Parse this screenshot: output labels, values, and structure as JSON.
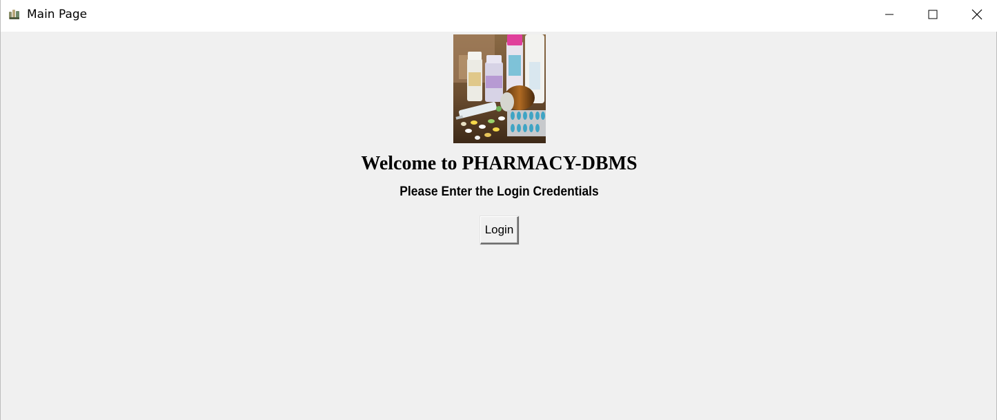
{
  "window": {
    "title": "Main Page",
    "app_icon": "pills-app-icon",
    "controls": [
      "minimize-icon",
      "maximize-icon",
      "close-icon"
    ]
  },
  "main": {
    "image": "medicine-bottles-and-pills-photo",
    "welcome_text": "Welcome to PHARMACY-DBMS",
    "subtitle": "Please Enter the Login Credentials",
    "login_label": "Login"
  },
  "colors": {
    "background": "#f0f0f0",
    "titlebar": "#ffffff",
    "text": "#000000"
  }
}
